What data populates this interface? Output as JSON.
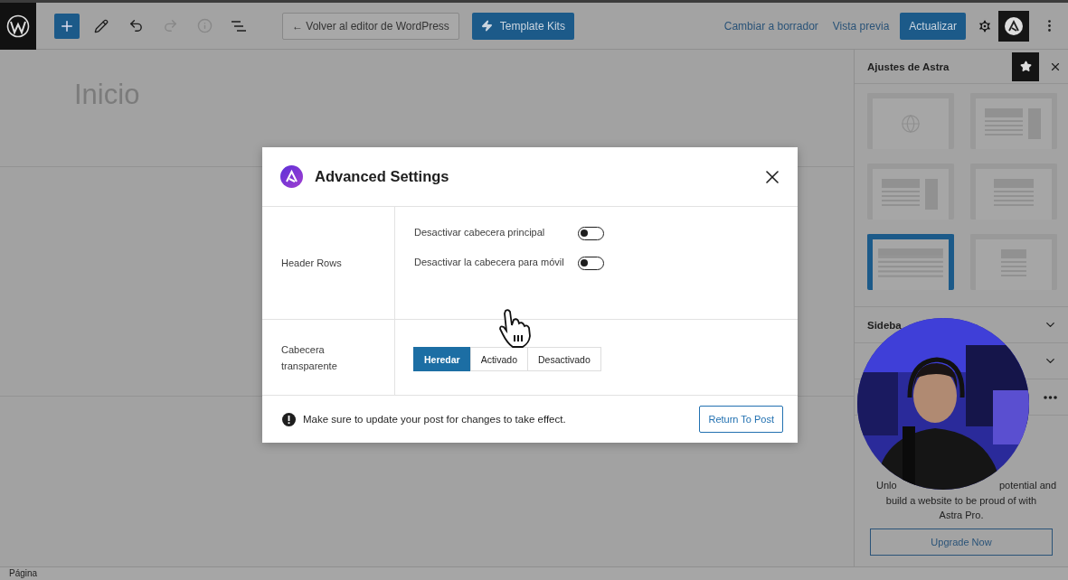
{
  "toolbar": {
    "back_button": "← Volver al editor de WordPress",
    "template_kits_button": "Template Kits",
    "links": [
      "Cambiar a borrador",
      "Vista previa"
    ],
    "update_button": "Actualizar"
  },
  "editor": {
    "title": "Inicio",
    "footer_label": "Página"
  },
  "sidebar": {
    "title": "Ajustes de Astra",
    "layouts": [
      {
        "kind": "globe",
        "selected": false
      },
      {
        "kind": "right-sidebar",
        "selected": false
      },
      {
        "kind": "right-sidebar",
        "selected": false
      },
      {
        "kind": "boxed",
        "selected": false
      },
      {
        "kind": "full-width",
        "selected": true
      },
      {
        "kind": "narrow",
        "selected": false
      }
    ],
    "sections": [
      {
        "kind": "chevron",
        "label": "Sideba"
      },
      {
        "kind": "chevron"
      },
      {
        "kind": "more"
      }
    ],
    "promo": {
      "line_start": "Unlo",
      "line_end": "potential and",
      "lines": [
        "build a website to be proud of with",
        "Astra Pro."
      ],
      "button": "Upgrade Now"
    }
  },
  "modal": {
    "title": "Advanced Settings",
    "rows": [
      {
        "kind": "toggles",
        "label": "Header Rows",
        "toggles": [
          {
            "label": "Desactivar cabecera principal",
            "on": false
          },
          {
            "label": "Desactivar la cabecera para móvil",
            "on": false
          }
        ]
      },
      {
        "kind": "segmented",
        "label": "Cabecera transparente",
        "options": [
          {
            "label": "Heredar",
            "selected": true
          },
          {
            "label": "Activado",
            "selected": false
          },
          {
            "label": "Desactivado",
            "selected": false
          }
        ]
      }
    ],
    "notice": "Make sure to update your post for changes to take effect.",
    "button": "Return To Post"
  }
}
